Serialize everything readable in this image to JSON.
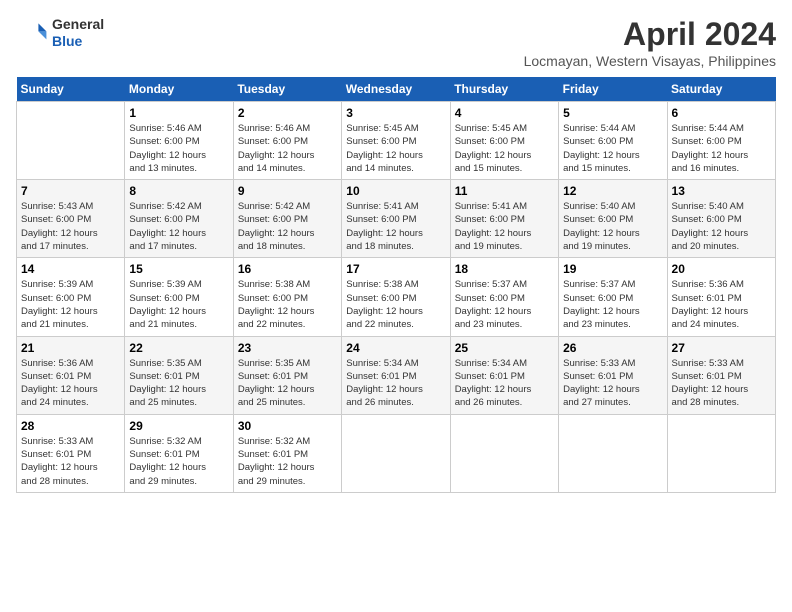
{
  "header": {
    "logo_line1": "General",
    "logo_line2": "Blue",
    "title": "April 2024",
    "subtitle": "Locmayan, Western Visayas, Philippines"
  },
  "calendar": {
    "days_of_week": [
      "Sunday",
      "Monday",
      "Tuesday",
      "Wednesday",
      "Thursday",
      "Friday",
      "Saturday"
    ],
    "weeks": [
      [
        {
          "day": "",
          "info": ""
        },
        {
          "day": "1",
          "info": "Sunrise: 5:46 AM\nSunset: 6:00 PM\nDaylight: 12 hours\nand 13 minutes."
        },
        {
          "day": "2",
          "info": "Sunrise: 5:46 AM\nSunset: 6:00 PM\nDaylight: 12 hours\nand 14 minutes."
        },
        {
          "day": "3",
          "info": "Sunrise: 5:45 AM\nSunset: 6:00 PM\nDaylight: 12 hours\nand 14 minutes."
        },
        {
          "day": "4",
          "info": "Sunrise: 5:45 AM\nSunset: 6:00 PM\nDaylight: 12 hours\nand 15 minutes."
        },
        {
          "day": "5",
          "info": "Sunrise: 5:44 AM\nSunset: 6:00 PM\nDaylight: 12 hours\nand 15 minutes."
        },
        {
          "day": "6",
          "info": "Sunrise: 5:44 AM\nSunset: 6:00 PM\nDaylight: 12 hours\nand 16 minutes."
        }
      ],
      [
        {
          "day": "7",
          "info": "Sunrise: 5:43 AM\nSunset: 6:00 PM\nDaylight: 12 hours\nand 17 minutes."
        },
        {
          "day": "8",
          "info": "Sunrise: 5:42 AM\nSunset: 6:00 PM\nDaylight: 12 hours\nand 17 minutes."
        },
        {
          "day": "9",
          "info": "Sunrise: 5:42 AM\nSunset: 6:00 PM\nDaylight: 12 hours\nand 18 minutes."
        },
        {
          "day": "10",
          "info": "Sunrise: 5:41 AM\nSunset: 6:00 PM\nDaylight: 12 hours\nand 18 minutes."
        },
        {
          "day": "11",
          "info": "Sunrise: 5:41 AM\nSunset: 6:00 PM\nDaylight: 12 hours\nand 19 minutes."
        },
        {
          "day": "12",
          "info": "Sunrise: 5:40 AM\nSunset: 6:00 PM\nDaylight: 12 hours\nand 19 minutes."
        },
        {
          "day": "13",
          "info": "Sunrise: 5:40 AM\nSunset: 6:00 PM\nDaylight: 12 hours\nand 20 minutes."
        }
      ],
      [
        {
          "day": "14",
          "info": "Sunrise: 5:39 AM\nSunset: 6:00 PM\nDaylight: 12 hours\nand 21 minutes."
        },
        {
          "day": "15",
          "info": "Sunrise: 5:39 AM\nSunset: 6:00 PM\nDaylight: 12 hours\nand 21 minutes."
        },
        {
          "day": "16",
          "info": "Sunrise: 5:38 AM\nSunset: 6:00 PM\nDaylight: 12 hours\nand 22 minutes."
        },
        {
          "day": "17",
          "info": "Sunrise: 5:38 AM\nSunset: 6:00 PM\nDaylight: 12 hours\nand 22 minutes."
        },
        {
          "day": "18",
          "info": "Sunrise: 5:37 AM\nSunset: 6:00 PM\nDaylight: 12 hours\nand 23 minutes."
        },
        {
          "day": "19",
          "info": "Sunrise: 5:37 AM\nSunset: 6:00 PM\nDaylight: 12 hours\nand 23 minutes."
        },
        {
          "day": "20",
          "info": "Sunrise: 5:36 AM\nSunset: 6:01 PM\nDaylight: 12 hours\nand 24 minutes."
        }
      ],
      [
        {
          "day": "21",
          "info": "Sunrise: 5:36 AM\nSunset: 6:01 PM\nDaylight: 12 hours\nand 24 minutes."
        },
        {
          "day": "22",
          "info": "Sunrise: 5:35 AM\nSunset: 6:01 PM\nDaylight: 12 hours\nand 25 minutes."
        },
        {
          "day": "23",
          "info": "Sunrise: 5:35 AM\nSunset: 6:01 PM\nDaylight: 12 hours\nand 25 minutes."
        },
        {
          "day": "24",
          "info": "Sunrise: 5:34 AM\nSunset: 6:01 PM\nDaylight: 12 hours\nand 26 minutes."
        },
        {
          "day": "25",
          "info": "Sunrise: 5:34 AM\nSunset: 6:01 PM\nDaylight: 12 hours\nand 26 minutes."
        },
        {
          "day": "26",
          "info": "Sunrise: 5:33 AM\nSunset: 6:01 PM\nDaylight: 12 hours\nand 27 minutes."
        },
        {
          "day": "27",
          "info": "Sunrise: 5:33 AM\nSunset: 6:01 PM\nDaylight: 12 hours\nand 28 minutes."
        }
      ],
      [
        {
          "day": "28",
          "info": "Sunrise: 5:33 AM\nSunset: 6:01 PM\nDaylight: 12 hours\nand 28 minutes."
        },
        {
          "day": "29",
          "info": "Sunrise: 5:32 AM\nSunset: 6:01 PM\nDaylight: 12 hours\nand 29 minutes."
        },
        {
          "day": "30",
          "info": "Sunrise: 5:32 AM\nSunset: 6:01 PM\nDaylight: 12 hours\nand 29 minutes."
        },
        {
          "day": "",
          "info": ""
        },
        {
          "day": "",
          "info": ""
        },
        {
          "day": "",
          "info": ""
        },
        {
          "day": "",
          "info": ""
        }
      ]
    ]
  }
}
